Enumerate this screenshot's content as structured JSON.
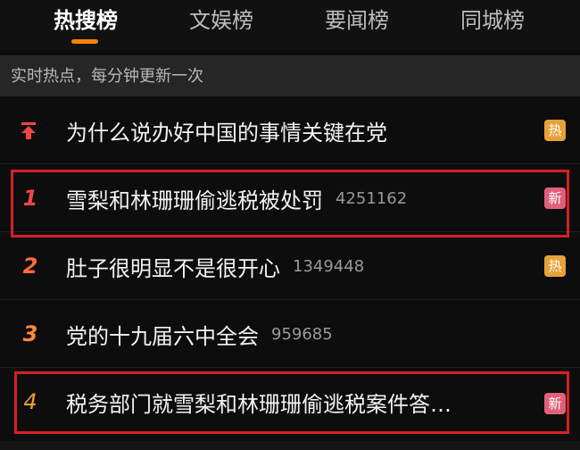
{
  "tabs": [
    {
      "label": "热搜榜",
      "active": true
    },
    {
      "label": "文娱榜",
      "active": false
    },
    {
      "label": "要闻榜",
      "active": false
    },
    {
      "label": "同城榜",
      "active": false
    }
  ],
  "subheader": "实时热点，每分钟更新一次",
  "pinned": {
    "icon": "pin-top-icon",
    "title": "为什么说办好中国的事情关键在党",
    "badge": "热"
  },
  "items": [
    {
      "rank": "1",
      "title": "雪梨和林珊珊偷逃税被处罚",
      "count": "4251162",
      "badge": "新"
    },
    {
      "rank": "2",
      "title": "肚子很明显不是很开心",
      "count": "1349448",
      "badge": "热"
    },
    {
      "rank": "3",
      "title": "党的十九届六中全会",
      "count": "959685",
      "badge": ""
    },
    {
      "rank": "4",
      "title": "税务部门就雪梨和林珊珊偷逃税案件答…",
      "count": "",
      "badge": "新"
    }
  ],
  "colors": {
    "accent": "#ff8200",
    "highlight_box": "#d81f25",
    "hot_badge": "#e8a13a",
    "new_badge": "#e0607a"
  }
}
